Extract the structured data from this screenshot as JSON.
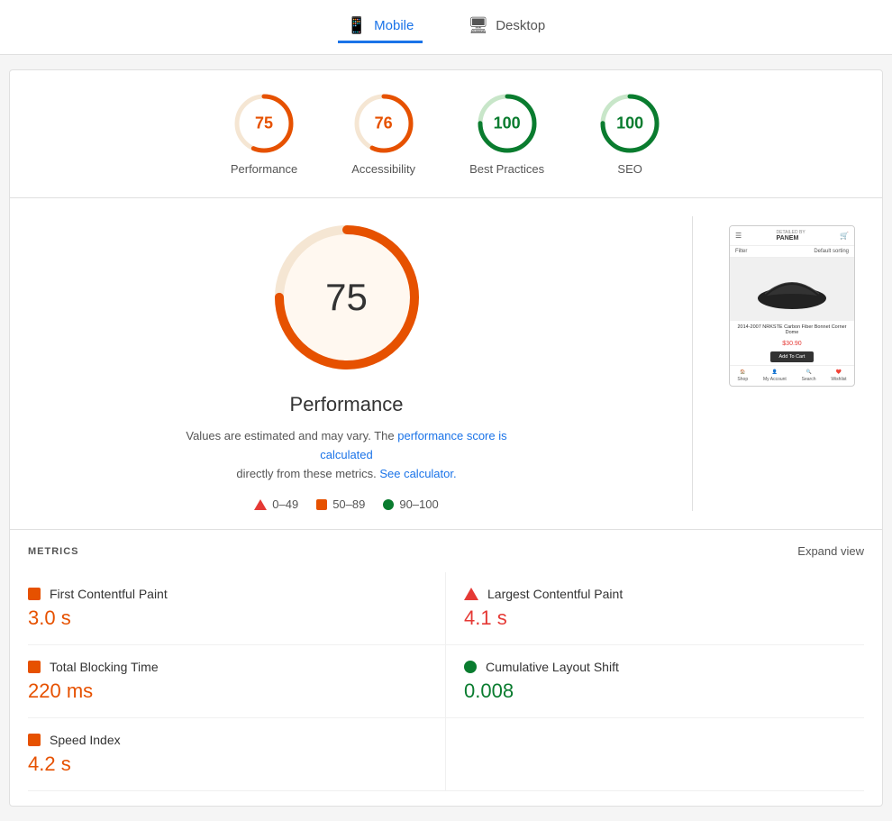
{
  "tabs": [
    {
      "id": "mobile",
      "label": "Mobile",
      "active": true,
      "icon": "📱"
    },
    {
      "id": "desktop",
      "label": "Desktop",
      "active": false,
      "icon": "🖥"
    }
  ],
  "scores": [
    {
      "id": "performance",
      "label": "Performance",
      "value": 75,
      "color": "#e65100",
      "bg": "#fff3e0",
      "strokeColor": "#e65100",
      "trackColor": "#f5e6d3"
    },
    {
      "id": "accessibility",
      "label": "Accessibility",
      "value": 76,
      "color": "#e65100",
      "bg": "#fff3e0",
      "strokeColor": "#e65100",
      "trackColor": "#f5e6d3"
    },
    {
      "id": "best-practices",
      "label": "Best Practices",
      "value": 100,
      "color": "#0a7c2f",
      "bg": "#e8f5e9",
      "strokeColor": "#0a7c2f",
      "trackColor": "#c8e6c9"
    },
    {
      "id": "seo",
      "label": "SEO",
      "value": 100,
      "color": "#0a7c2f",
      "bg": "#e8f5e9",
      "strokeColor": "#0a7c2f",
      "trackColor": "#c8e6c9"
    }
  ],
  "main": {
    "big_score": "75",
    "title": "Performance",
    "info_text": "Values are estimated and may vary. The",
    "info_link1": "performance score is calculated",
    "info_mid": "directly from these metrics.",
    "info_link2": "See calculator.",
    "legend": [
      {
        "label": "0–49",
        "type": "triangle",
        "color": "#e53935"
      },
      {
        "label": "50–89",
        "type": "square",
        "color": "#e65100"
      },
      {
        "label": "90–100",
        "type": "circle",
        "color": "#0a7c2f"
      }
    ]
  },
  "metrics": {
    "title": "METRICS",
    "expand_label": "Expand view",
    "items": [
      {
        "id": "fcp",
        "name": "First Contentful Paint",
        "value": "3.0 s",
        "color": "orange",
        "indicator": "square"
      },
      {
        "id": "lcp",
        "name": "Largest Contentful Paint",
        "value": "4.1 s",
        "color": "red",
        "indicator": "triangle"
      },
      {
        "id": "tbt",
        "name": "Total Blocking Time",
        "value": "220 ms",
        "color": "orange",
        "indicator": "square"
      },
      {
        "id": "cls",
        "name": "Cumulative Layout Shift",
        "value": "0.008",
        "color": "green",
        "indicator": "circle"
      },
      {
        "id": "si",
        "name": "Speed Index",
        "value": "4.2 s",
        "color": "orange",
        "indicator": "square"
      }
    ]
  },
  "phone_preview": {
    "brand": "DETAILED BY PANEM",
    "filter": "Filter",
    "sort": "Default sorting",
    "product_desc": "2014-2007 NRKSTE Carbon Fiber Bonnet Corner Dome",
    "price": "$30.90",
    "add_to_cart": "Add To Cart",
    "nav_items": [
      "Shop",
      "My Account",
      "Search",
      "Wishlist"
    ]
  }
}
